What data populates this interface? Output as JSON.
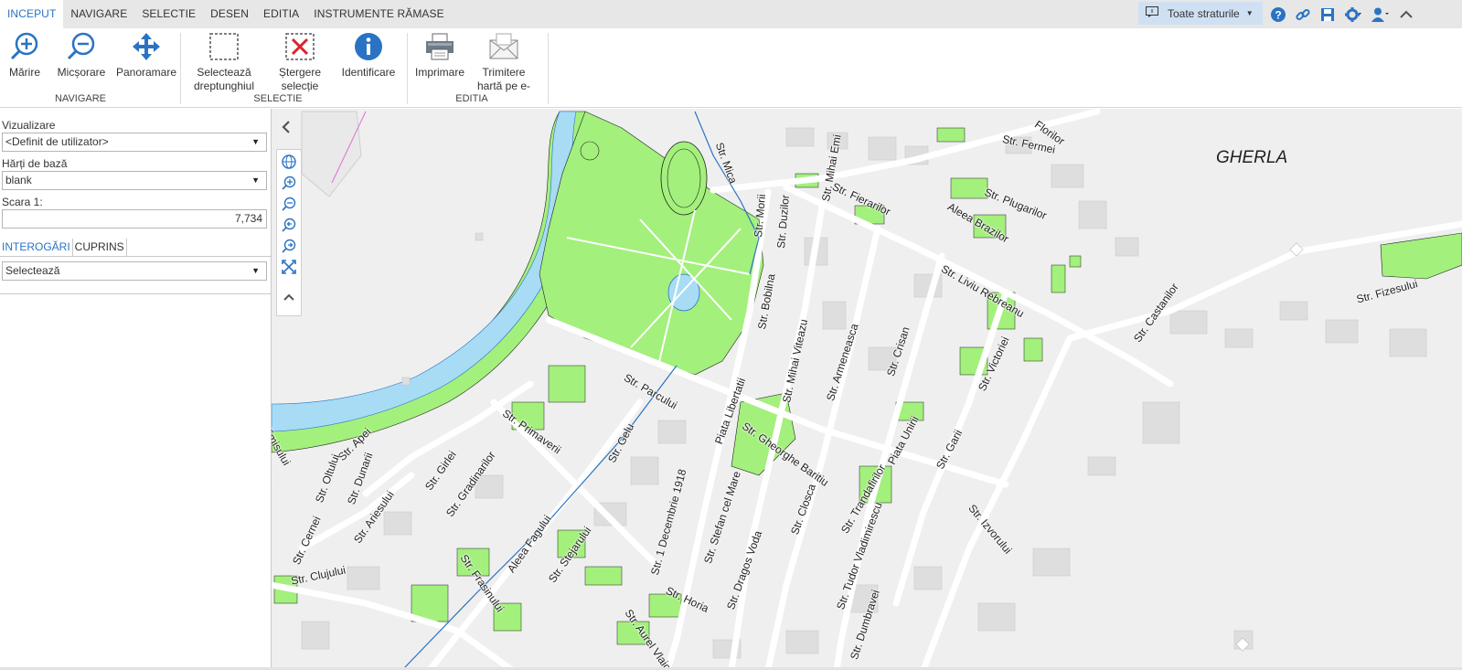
{
  "tabs": [
    "INCEPUT",
    "NAVIGARE",
    "SELECTIE",
    "DESEN",
    "EDITIA",
    "INSTRUMENTE RĂMASE"
  ],
  "layer_selector": {
    "label": "Toate straturile"
  },
  "ribbon": {
    "buttons": {
      "zoom_in": "Mărire",
      "zoom_out": "Micșorare",
      "pan": "Panoramare",
      "select_rect_1": "Selectează",
      "select_rect_2": "dreptunghiul",
      "clear_sel_1": "Ștergere",
      "clear_sel_2": "selecție",
      "identify": "Identificare",
      "print": "Imprimare",
      "email_1": "Trimitere",
      "email_2": "hartă pe e-"
    },
    "groups": {
      "nav": "NAVIGARE",
      "sel": "SELECTIE",
      "edit": "EDITIA"
    }
  },
  "panel": {
    "view_label": "Vizualizare",
    "view_value": "<Definit de utilizator>",
    "basemap_label": "Hărți de bază",
    "basemap_value": "blank",
    "scale_label": "Scara 1:",
    "scale_value": "7,734",
    "subtabs": [
      "INTEROGĂRI",
      "CUPRINS"
    ],
    "query_value": "Selectează"
  },
  "map": {
    "place": "GHERLA",
    "streets": {
      "fermei": "Str. Fermei",
      "plugarilor": "Str. Plugarilor",
      "fierarilor": "Str. Fierarilor",
      "brazilor": "Aleea Brazilor",
      "rebreanu": "Str. Liviu Rebreanu",
      "castanilor": "Str. Castanilor",
      "fizesului": "Str. Fizesului",
      "victoriei": "Str. Victoriei",
      "crisan": "Str. Crisan",
      "armeneasca": "Str. Armeneasca",
      "viteazu": "Str. Mihai Viteazu",
      "bobilna": "Str. Bobilna",
      "duzilor": "Str. Duzilor",
      "morii": "Str. Morii",
      "mica": "Str. Mica",
      "parcului": "Str. Parcului",
      "libertatii": "Piata Libertatii",
      "baritiu": "Str. Gheorghe Baritiu",
      "unirii": "Piata Unirii",
      "garii": "Str. Garii",
      "tranda": "Str. Trandafirilor",
      "izvorului": "Str. Izvorului",
      "vladimirescu": "Str. Tudor Vladimirescu",
      "dumbravei": "Str. Dumbravei",
      "closca": "Str. Closca",
      "voda": "Str. Dragos Voda",
      "stefan": "Str. Stefan cel Mare",
      "decembrie": "Str. 1 Decembrie 1918",
      "horia": "Str. Horia",
      "vlaicu": "Str. Aurel Vlaicu",
      "gelu": "Str. Gelu",
      "primaverii": "Str. Primaverii",
      "girlei": "Str. Girlei",
      "gradinarilor": "Str. Gradinarilor",
      "fagului": "Aleea Fagului",
      "stejarului": "Str. Stejarului",
      "frasinului": "Str. Frasinului",
      "clujului": "Str. Clujului",
      "apei": "Str. Apei",
      "dunarii": "Str. Dunarii",
      "oltului": "Str. Oltului",
      "ariesului": "Str. Ariesului",
      "cernei": "Str. Cernei",
      "timisului": "Timisului",
      "ul": "ul",
      "mihai_em": "Str. Mihai Emi",
      "florilor": "Florilor"
    }
  },
  "colors": {
    "accent": "#2a73c4",
    "green": "#a3f07c",
    "water": "#a8dcf5",
    "road": "#ffffff"
  }
}
